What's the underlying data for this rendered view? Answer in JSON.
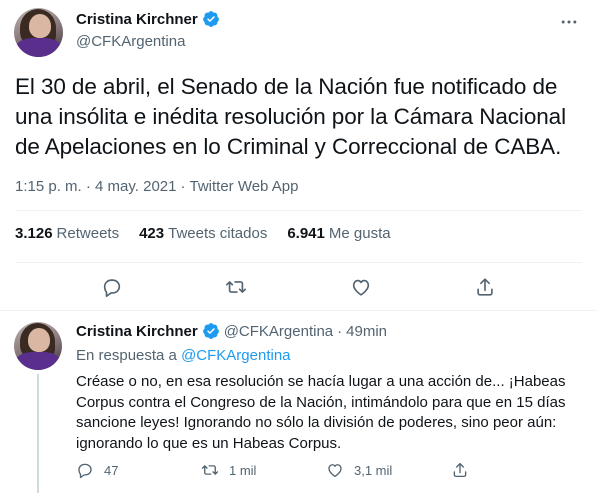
{
  "main_tweet": {
    "author_name": "Cristina Kirchner",
    "author_handle": "@CFKArgentina",
    "text": "El 30 de abril, el Senado de la Nación fue notificado de una insólita e inédita resolución por la Cámara Nacional de Apelaciones en lo Criminal y Correccional de CABA.",
    "timestamp": "1:15 p. m. · 4 may. 2021",
    "separator": "·",
    "source_app": "Twitter Web App",
    "stats": {
      "retweets_count": "3.126",
      "retweets_label": "Retweets",
      "quotes_count": "423",
      "quotes_label": "Tweets citados",
      "likes_count": "6.941",
      "likes_label": "Me gusta"
    },
    "actions": [
      "reply-icon",
      "retweet-icon",
      "like-icon",
      "share-icon"
    ]
  },
  "reply_tweet": {
    "author_name": "Cristina Kirchner",
    "author_handle": "@CFKArgentina",
    "dot": "·",
    "time": "49min",
    "in_reply_prefix": "En respuesta a",
    "in_reply_mention": "@CFKArgentina",
    "text": "Créase o no, en esa resolución se hacía lugar a una acción de... ¡Habeas Corpus contra el Congreso de la Nación, intimándolo para que en 15 días sancione leyes! Ignorando no sólo la división de poderes, sino peor aún: ignorando lo que es un Habeas Corpus.",
    "actions": {
      "reply_count": "47",
      "retweet_count": "1 mil",
      "like_count": "3,1 mil",
      "share_count": ""
    }
  },
  "colors": {
    "text_primary": "#0f1419",
    "text_secondary": "#536471",
    "accent": "#1d9bf0",
    "divider": "#eff3f4"
  }
}
